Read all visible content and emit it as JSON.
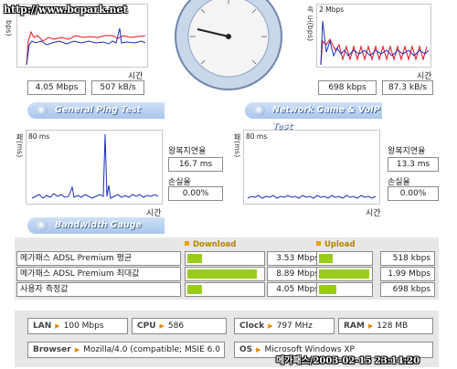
{
  "watermark": "http://www.bcpark.net",
  "timestamp": "메가패스/2003-02-15 23:14:20",
  "speed": {
    "left": {
      "y_label": "bps)",
      "x_label": "시간",
      "value_mbps": "4.05 Mbps",
      "value_kbs": "507 kB/s"
    },
    "right": {
      "y_label": "속 도(bps)",
      "scale_max": "2 Mbps",
      "x_label": "시간",
      "value_kbps": "698 kbps",
      "value_kbs": "87.3 kB/s"
    },
    "gauge": {
      "icon": "speedometer-gauge",
      "ticks": [
        "100K",
        "200K",
        "500K",
        "1M",
        "2M",
        "4M",
        "6M",
        "8M",
        "10M"
      ]
    }
  },
  "sections": {
    "ping_title": "General Ping Test",
    "game_title": "Network Game & VoIP Test",
    "bandwidth_title": "Bandwidth Gauge"
  },
  "ping": {
    "left": {
      "y_label": "패(ms)",
      "scale_max": "80 ms",
      "x_label": "시간",
      "latency_label": "왕복지연율",
      "latency_value": "16.7 ms",
      "loss_label": "손실율",
      "loss_value": "0.00%"
    },
    "right": {
      "y_label": "패(ms)",
      "scale_max": "80 ms",
      "x_label": "시간",
      "latency_label": "왕복지연율",
      "latency_value": "13.3 ms",
      "loss_label": "손실율",
      "loss_value": "0.00%"
    }
  },
  "bandwidth": {
    "download_head": "Download",
    "upload_head": "Upload",
    "rows": [
      {
        "label": "메가패스 ADSL Premium 평균",
        "download": "3.53 Mbps",
        "download_fill": 0.2,
        "upload": "518 kbps",
        "upload_fill": 0.26
      },
      {
        "label": "메가패스 ADSL Premium 최대값",
        "download": "8.89 Mbps",
        "download_fill": 0.93,
        "upload": "1.99 Mbps",
        "upload_fill": 0.99
      },
      {
        "label": "사용자 측정값",
        "download": "4.05 Mbps",
        "download_fill": 0.2,
        "upload": "698 kbps",
        "upload_fill": 0.34
      }
    ]
  },
  "system_info": {
    "lan_label": "LAN",
    "lan_value": "100 Mbps",
    "cpu_label": "CPU",
    "cpu_value": "586",
    "clock_label": "Clock",
    "clock_value": "797 MHz",
    "ram_label": "RAM",
    "ram_value": "128 MB",
    "browser_label": "Browser",
    "browser_value": "Mozilla/4.0 (compatible; MSIE 6.0",
    "os_label": "OS",
    "os_value": "Microsoft Windows XP"
  },
  "colors": {
    "accent_bar": "#9acc1d",
    "header_blue": "#a9c6ec",
    "chart_blue": "#1a2fb8",
    "chart_red": "#e0121c"
  }
}
